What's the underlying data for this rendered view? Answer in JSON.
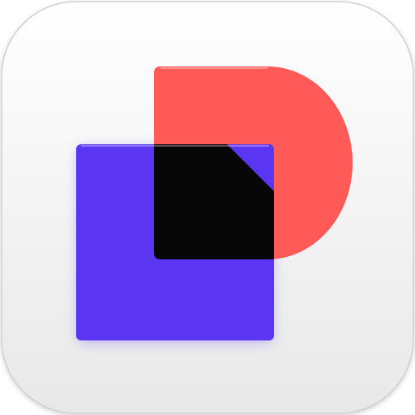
{
  "app_icon": {
    "icon": "documents-overlap-icon",
    "colors": {
      "tile_top": "#ffffff",
      "tile_bottom": "#e8e8e8",
      "red_shape": "#ff5a58",
      "purple_square": "#5a35f2",
      "overlap": "#070707"
    }
  }
}
